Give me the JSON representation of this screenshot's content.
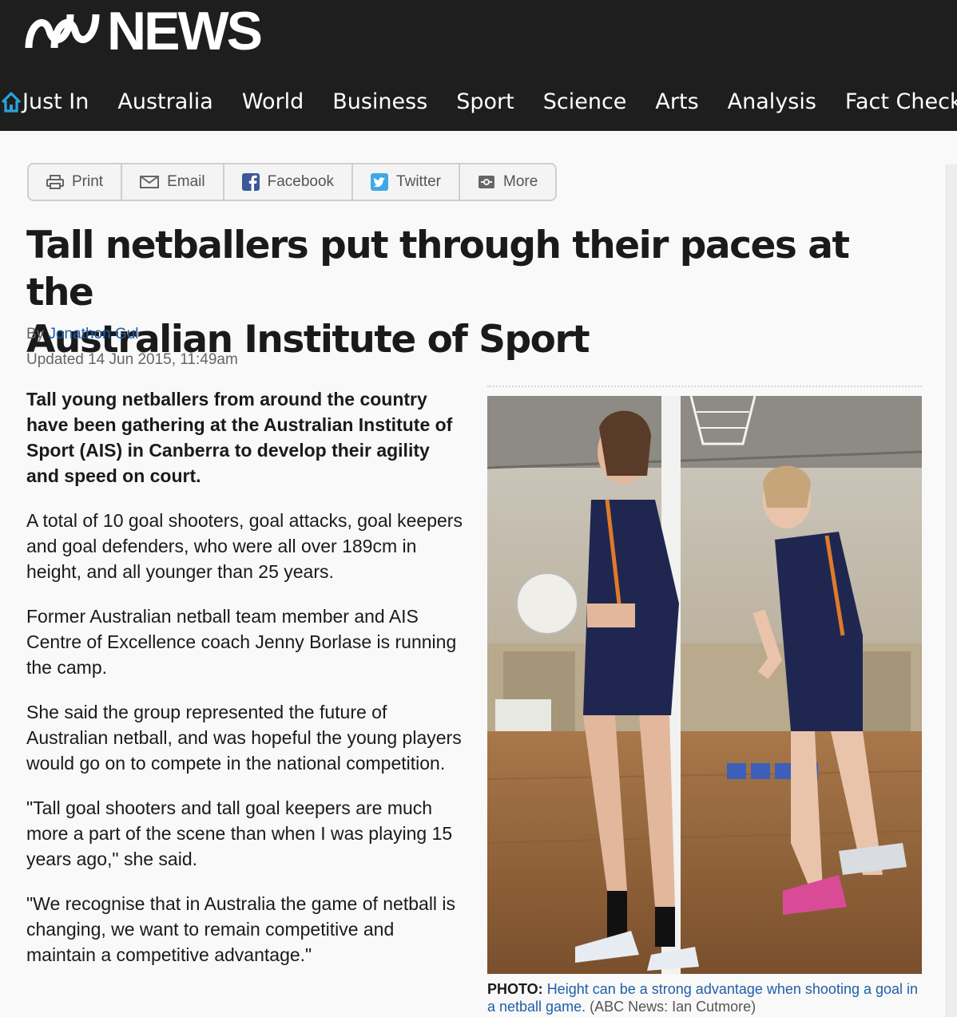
{
  "header": {
    "logo_text": "NEWS",
    "nav": [
      "Just In",
      "Australia",
      "World",
      "Business",
      "Sport",
      "Science",
      "Arts",
      "Analysis",
      "Fact Check"
    ]
  },
  "share": {
    "print": "Print",
    "email": "Email",
    "facebook": "Facebook",
    "twitter": "Twitter",
    "more": "More"
  },
  "article": {
    "headline_line1": "Tall netballers put through their paces at the",
    "headline_line2": "Australian Institute of Sport",
    "by_prefix": "By",
    "author": "Jonathon Gul",
    "updated": "Updated 14 Jun 2015, 11:49am",
    "lede": "Tall young netballers from around the country have been gathering at the Australian Institute of Sport (AIS) in Canberra to develop their agility and speed on court.",
    "paragraphs": [
      "A total of 10 goal shooters, goal attacks, goal keepers and goal defenders, who were all over 189cm in height, and all younger than 25 years.",
      "Former Australian netball team member and AIS Centre of Excellence coach Jenny Borlase is running the camp.",
      "She said the group represented the future of Australian netball, and was hopeful the young players would go on to compete in the national competition.",
      "\"Tall goal shooters and tall goal keepers are much more a part of the scene than when I was playing 15 years ago,\" she said.",
      "\"We recognise that in Australia the game of netball is changing, we want to remain competitive and maintain a competitive advantage.\""
    ]
  },
  "photo": {
    "label": "PHOTO:",
    "caption": "Height can be a strong advantage when shooting a goal in a netball game.",
    "credit": "(ABC News: Ian Cutmore)"
  },
  "colors": {
    "header_bg": "#1e1e1e",
    "link": "#1f5ea8",
    "home_icon": "#2aa3e0"
  }
}
